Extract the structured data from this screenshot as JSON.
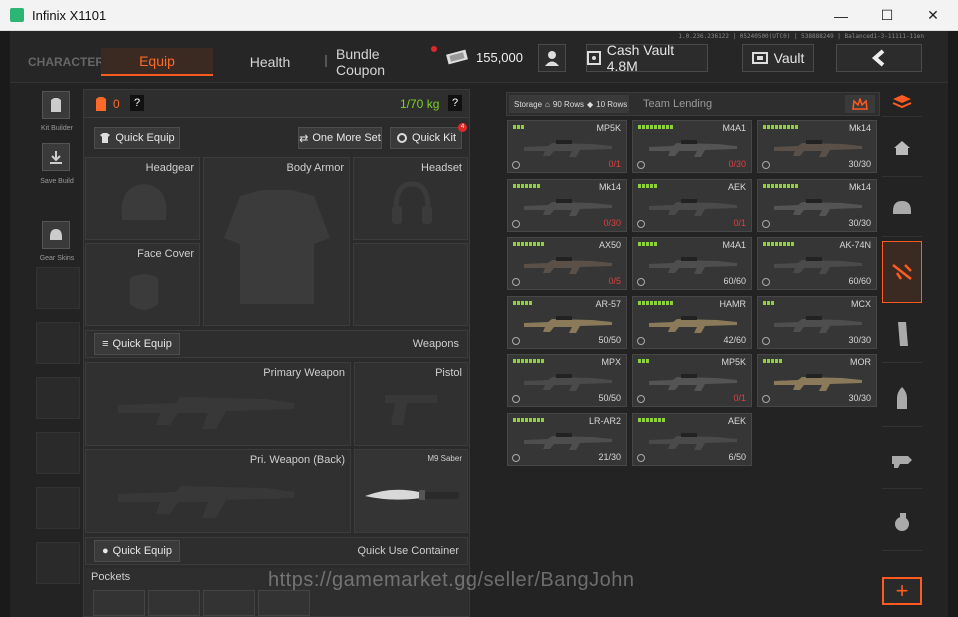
{
  "window": {
    "title": "Infinix X1101",
    "minimize": "—",
    "maximize": "☐",
    "close": "✕"
  },
  "version_text": "1.0.236.236122 | 05240500(UTC0) | 538888249 | Balanced1-3-11111-11en",
  "tabs": {
    "character": "CHARACTER",
    "equip": "Equip",
    "health": "Health",
    "bundle": "Bundle Coupon"
  },
  "currency": {
    "koens": "155,000",
    "cash_vault": "Cash Vault 4.8M",
    "vault": "Vault"
  },
  "left_nav": {
    "kit_builder": "Kit Builder",
    "save_build": "Save Build",
    "gear_skins": "Gear Skins"
  },
  "loadout": {
    "armor_value": "0",
    "help": "?",
    "weight": "1/70 kg",
    "quick_equip": "Quick Equip",
    "one_more_set": "One More Set",
    "quick_kit": "Quick Kit",
    "quick_kit_badge": "4",
    "slots": {
      "headgear": "Headgear",
      "body_armor": "Body Armor",
      "headset": "Headset",
      "face_cover": "Face Cover"
    },
    "weapons_title": "Weapons",
    "weapon_slots": {
      "primary": "Primary Weapon",
      "pistol": "Pistol",
      "primary_back": "Pri. Weapon (Back)",
      "melee": "M9 Saber"
    },
    "quick_use_title": "Quick Use Container",
    "pockets": "Pockets"
  },
  "storage": {
    "label": "Storage",
    "rows_a": "90 Rows",
    "rows_b": "10 Rows",
    "team_lending": "Team Lending"
  },
  "weapons": [
    {
      "name": "MP5K",
      "ammo": "0",
      "cap": "/1",
      "low": true,
      "bars": 3
    },
    {
      "name": "M4A1",
      "ammo": "0",
      "cap": "/30",
      "low": true,
      "bars": 9
    },
    {
      "name": "Mk14",
      "ammo": "30",
      "cap": "/30",
      "low": false,
      "bars": 9
    },
    {
      "name": "Mk14",
      "ammo": "0",
      "cap": "/30",
      "low": true,
      "bars": 7
    },
    {
      "name": "AEK",
      "ammo": "0",
      "cap": "/1",
      "low": true,
      "bars": 5
    },
    {
      "name": "Mk14",
      "ammo": "30",
      "cap": "/30",
      "low": false,
      "bars": 9
    },
    {
      "name": "AX50",
      "ammo": "0",
      "cap": "/5",
      "low": true,
      "bars": 8
    },
    {
      "name": "M4A1",
      "ammo": "60",
      "cap": "/60",
      "low": false,
      "bars": 5
    },
    {
      "name": "AK-74N",
      "ammo": "60",
      "cap": "/60",
      "low": false,
      "bars": 8
    },
    {
      "name": "AR-57",
      "ammo": "50",
      "cap": "/50",
      "low": false,
      "bars": 5
    },
    {
      "name": "HAMR",
      "ammo": "42",
      "cap": "/60",
      "low": false,
      "bars": 9
    },
    {
      "name": "MCX",
      "ammo": "30",
      "cap": "/30",
      "low": false,
      "bars": 3
    },
    {
      "name": "MPX",
      "ammo": "50",
      "cap": "/50",
      "low": false,
      "bars": 8
    },
    {
      "name": "MP5K",
      "ammo": "0",
      "cap": "/1",
      "low": true,
      "bars": 3
    },
    {
      "name": "MOR",
      "ammo": "30",
      "cap": "/30",
      "low": false,
      "bars": 5
    },
    {
      "name": "LR-AR2",
      "ammo": "21",
      "cap": "/30",
      "low": false,
      "bars": 8
    },
    {
      "name": "AEK",
      "ammo": "6",
      "cap": "/50",
      "low": false,
      "bars": 7
    }
  ],
  "add_button": "+",
  "watermark": "https://gamemarket.gg/seller/BangJohn",
  "colors": {
    "accent": "#ff5a1f",
    "weight_green": "#7ed321",
    "bar_green": "#8fd13a",
    "ammo_low": "#e04040"
  }
}
